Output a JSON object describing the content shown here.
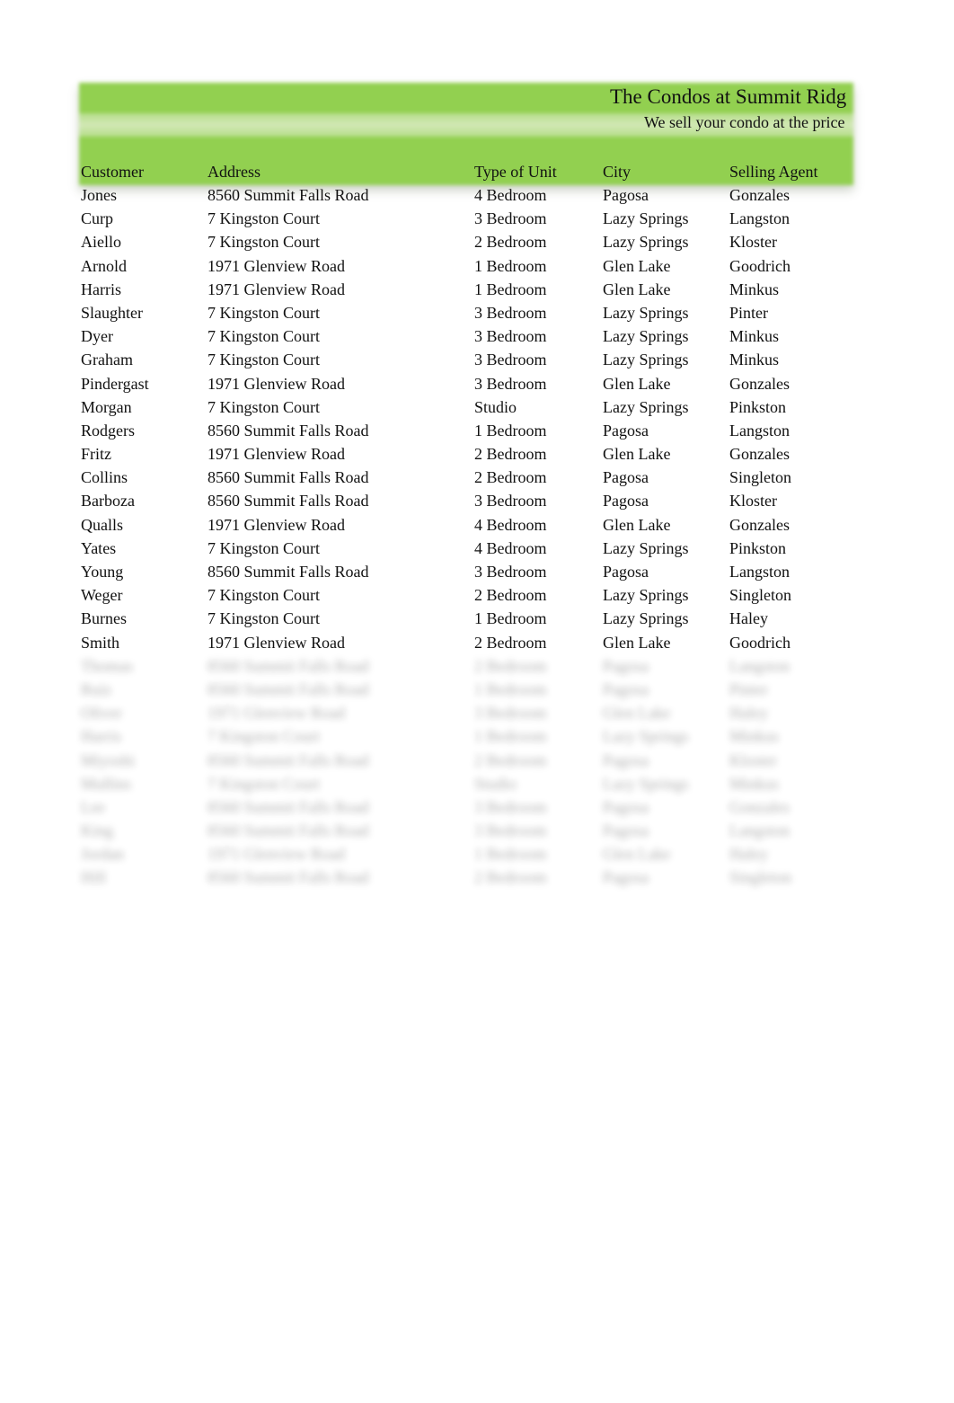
{
  "header": {
    "title": "The Condos at Summit Ridg",
    "subtitle": "We sell your condo at the price",
    "banner_color": "#92d050",
    "banner_highlight_color": "#d2e8b6"
  },
  "table": {
    "columns": [
      "Customer",
      "Address",
      "Type of Unit",
      "City",
      "Selling Agent"
    ],
    "rows": [
      {
        "customer": "Jones",
        "address": "8560 Summit Falls Road",
        "type": "4 Bedroom",
        "city": "Pagosa",
        "agent": "Gonzales"
      },
      {
        "customer": "Curp",
        "address": "7 Kingston Court",
        "type": "3 Bedroom",
        "city": "Lazy Springs",
        "agent": "Langston"
      },
      {
        "customer": "Aiello",
        "address": "7 Kingston Court",
        "type": "2 Bedroom",
        "city": "Lazy Springs",
        "agent": "Kloster"
      },
      {
        "customer": "Arnold",
        "address": "1971 Glenview Road",
        "type": "1 Bedroom",
        "city": "Glen Lake",
        "agent": "Goodrich"
      },
      {
        "customer": "Harris",
        "address": "1971 Glenview Road",
        "type": "1 Bedroom",
        "city": "Glen Lake",
        "agent": "Minkus"
      },
      {
        "customer": "Slaughter",
        "address": "7 Kingston Court",
        "type": "3 Bedroom",
        "city": "Lazy Springs",
        "agent": "Pinter"
      },
      {
        "customer": "Dyer",
        "address": "7 Kingston Court",
        "type": "3 Bedroom",
        "city": "Lazy Springs",
        "agent": "Minkus"
      },
      {
        "customer": "Graham",
        "address": "7 Kingston Court",
        "type": "3 Bedroom",
        "city": "Lazy Springs",
        "agent": "Minkus"
      },
      {
        "customer": "Pindergast",
        "address": "1971 Glenview Road",
        "type": "3 Bedroom",
        "city": "Glen Lake",
        "agent": "Gonzales"
      },
      {
        "customer": "Morgan",
        "address": "7 Kingston Court",
        "type": "Studio",
        "city": "Lazy Springs",
        "agent": "Pinkston"
      },
      {
        "customer": "Rodgers",
        "address": "8560 Summit Falls Road",
        "type": "1 Bedroom",
        "city": "Pagosa",
        "agent": "Langston"
      },
      {
        "customer": "Fritz",
        "address": "1971 Glenview Road",
        "type": "2 Bedroom",
        "city": "Glen Lake",
        "agent": "Gonzales"
      },
      {
        "customer": "Collins",
        "address": "8560 Summit Falls Road",
        "type": "2 Bedroom",
        "city": "Pagosa",
        "agent": "Singleton"
      },
      {
        "customer": "Barboza",
        "address": "8560 Summit Falls Road",
        "type": "3 Bedroom",
        "city": "Pagosa",
        "agent": "Kloster"
      },
      {
        "customer": "Qualls",
        "address": "1971 Glenview Road",
        "type": "4 Bedroom",
        "city": "Glen Lake",
        "agent": "Gonzales"
      },
      {
        "customer": "Yates",
        "address": "7 Kingston Court",
        "type": "4 Bedroom",
        "city": "Lazy Springs",
        "agent": "Pinkston"
      },
      {
        "customer": "Young",
        "address": "8560 Summit Falls Road",
        "type": "3 Bedroom",
        "city": "Pagosa",
        "agent": "Langston"
      },
      {
        "customer": "Weger",
        "address": "7 Kingston Court",
        "type": "2 Bedroom",
        "city": "Lazy Springs",
        "agent": "Singleton"
      },
      {
        "customer": "Burnes",
        "address": "7 Kingston Court",
        "type": "1 Bedroom",
        "city": "Lazy Springs",
        "agent": "Haley"
      },
      {
        "customer": "Smith",
        "address": "1971 Glenview Road",
        "type": "2 Bedroom",
        "city": "Glen Lake",
        "agent": "Goodrich"
      }
    ],
    "obscured_rows": [
      {
        "customer": "Thomas",
        "address": "8560 Summit Falls Road",
        "type": "2 Bedroom",
        "city": "Pagosa",
        "agent": "Langston"
      },
      {
        "customer": "Ruiz",
        "address": "8560 Summit Falls Road",
        "type": "1 Bedroom",
        "city": "Pagosa",
        "agent": "Pinter"
      },
      {
        "customer": "Oliver",
        "address": "1971 Glenview Road",
        "type": "3 Bedroom",
        "city": "Glen Lake",
        "agent": "Haley"
      },
      {
        "customer": "Harris",
        "address": "7 Kingston Court",
        "type": "1 Bedroom",
        "city": "Lazy Springs",
        "agent": "Minkus"
      },
      {
        "customer": "Miyoshi",
        "address": "8560 Summit Falls Road",
        "type": "2 Bedroom",
        "city": "Pagosa",
        "agent": "Kloster"
      },
      {
        "customer": "Mullins",
        "address": "7 Kingston Court",
        "type": "Studio",
        "city": "Lazy Springs",
        "agent": "Minkus"
      },
      {
        "customer": "Lee",
        "address": "8560 Summit Falls Road",
        "type": "3 Bedroom",
        "city": "Pagosa",
        "agent": "Gonzales"
      },
      {
        "customer": "King",
        "address": "8560 Summit Falls Road",
        "type": "3 Bedroom",
        "city": "Pagosa",
        "agent": "Langston"
      },
      {
        "customer": "Jordan",
        "address": "1971 Glenview Road",
        "type": "1 Bedroom",
        "city": "Glen Lake",
        "agent": "Haley"
      },
      {
        "customer": "Hill",
        "address": "8560 Summit Falls Road",
        "type": "2 Bedroom",
        "city": "Pagosa",
        "agent": "Singleton"
      }
    ]
  }
}
